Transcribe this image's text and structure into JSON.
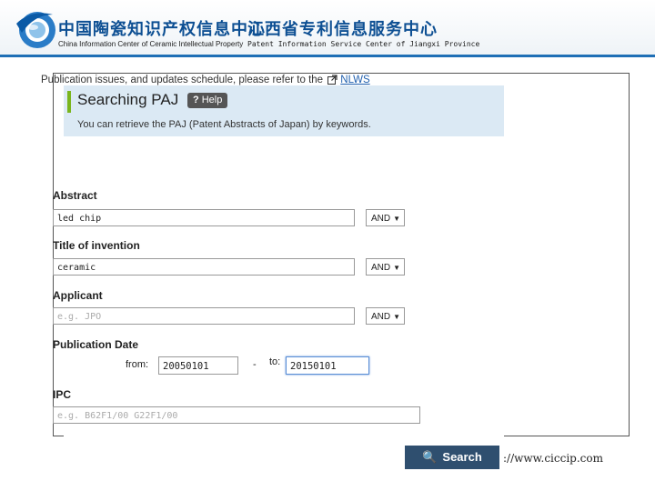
{
  "header": {
    "left_title_cn": "中国陶瓷知识产权信息中心",
    "left_title_en": "China Information Center of Ceramic Intellectual Property",
    "right_title_cn": "江西省专利信息服务中心",
    "right_title_en": "Patent Information Service Center of Jiangxi Province",
    "brand_color": "#1f6fb6"
  },
  "paj": {
    "title": "Searching PAJ",
    "help_label": "Help",
    "help_icon": "?",
    "description": "You can retrieve the PAJ (Patent Abstracts of Japan) by keywords.",
    "notice_prefix": "Publication issues, and updates schedule, please refer to the",
    "notice_link": "NLWS",
    "fields": {
      "abstract": {
        "label": "Abstract",
        "value": "led chip",
        "operator": "AND"
      },
      "title": {
        "label": "Title of invention",
        "value": "ceramic",
        "operator": "AND"
      },
      "applicant": {
        "label": "Applicant",
        "placeholder": "e.g. JPO",
        "operator": "AND"
      },
      "pubdate": {
        "label": "Publication Date",
        "from_label": "from:",
        "from_value": "20050101",
        "dash": "-",
        "to_label": "to:",
        "to_value": "20150101"
      },
      "ipc": {
        "label": "IPC",
        "placeholder": "e.g. B62F1/00 G22F1/00"
      }
    },
    "search_label": "Search"
  },
  "footer": {
    "url": "://www.ciccip.com"
  }
}
